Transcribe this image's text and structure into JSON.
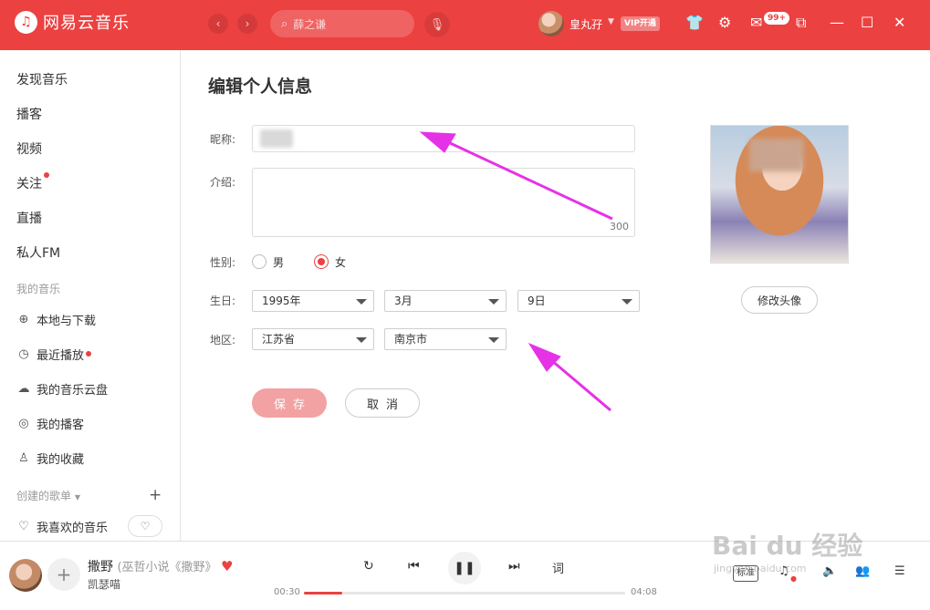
{
  "app": {
    "name": "网易云音乐"
  },
  "topbar": {
    "search_placeholder": "薛之谦",
    "username": "皇丸孖",
    "vip_label": "VIP开通",
    "message_badge": "99+"
  },
  "sidebar": {
    "main_items": [
      {
        "label": "发现音乐"
      },
      {
        "label": "播客"
      },
      {
        "label": "视频"
      },
      {
        "label": "关注"
      },
      {
        "label": "直播"
      },
      {
        "label": "私人FM"
      }
    ],
    "my_music_header": "我的音乐",
    "my_music_items": [
      {
        "label": "本地与下载"
      },
      {
        "label": "最近播放"
      },
      {
        "label": "我的音乐云盘"
      },
      {
        "label": "我的播客"
      },
      {
        "label": "我的收藏"
      }
    ],
    "created_playlists_header": "创建的歌单",
    "favorite_playlist": "我喜欢的音乐"
  },
  "form": {
    "title": "编辑个人信息",
    "nickname_label": "昵称:",
    "intro_label": "介绍:",
    "intro_count": "300",
    "gender_label": "性别:",
    "gender_male": "男",
    "gender_female": "女",
    "gender_selected": "female",
    "birthday_label": "生日:",
    "birthday_year": "1995年",
    "birthday_month": "3月",
    "birthday_day": "9日",
    "region_label": "地区:",
    "region_province": "江苏省",
    "region_city": "南京市",
    "save_label": "保存",
    "cancel_label": "取消",
    "change_avatar_label": "修改头像"
  },
  "player": {
    "song_title": "撒野",
    "song_subtitle": "(巫哲小说《撒野》",
    "artist": "凯瑟喵",
    "lyrics_label": "词",
    "current_time": "00:30",
    "total_time": "04:08",
    "progress": 0.12,
    "quality_label": "标准"
  },
  "watermark": {
    "text": "Bai du 经验",
    "sub": "jingyan.baidu.com"
  },
  "colors": {
    "brand": "#ec4141",
    "save_disabled": "#f2a2a2",
    "annotation_arrow": "#e632e6"
  }
}
